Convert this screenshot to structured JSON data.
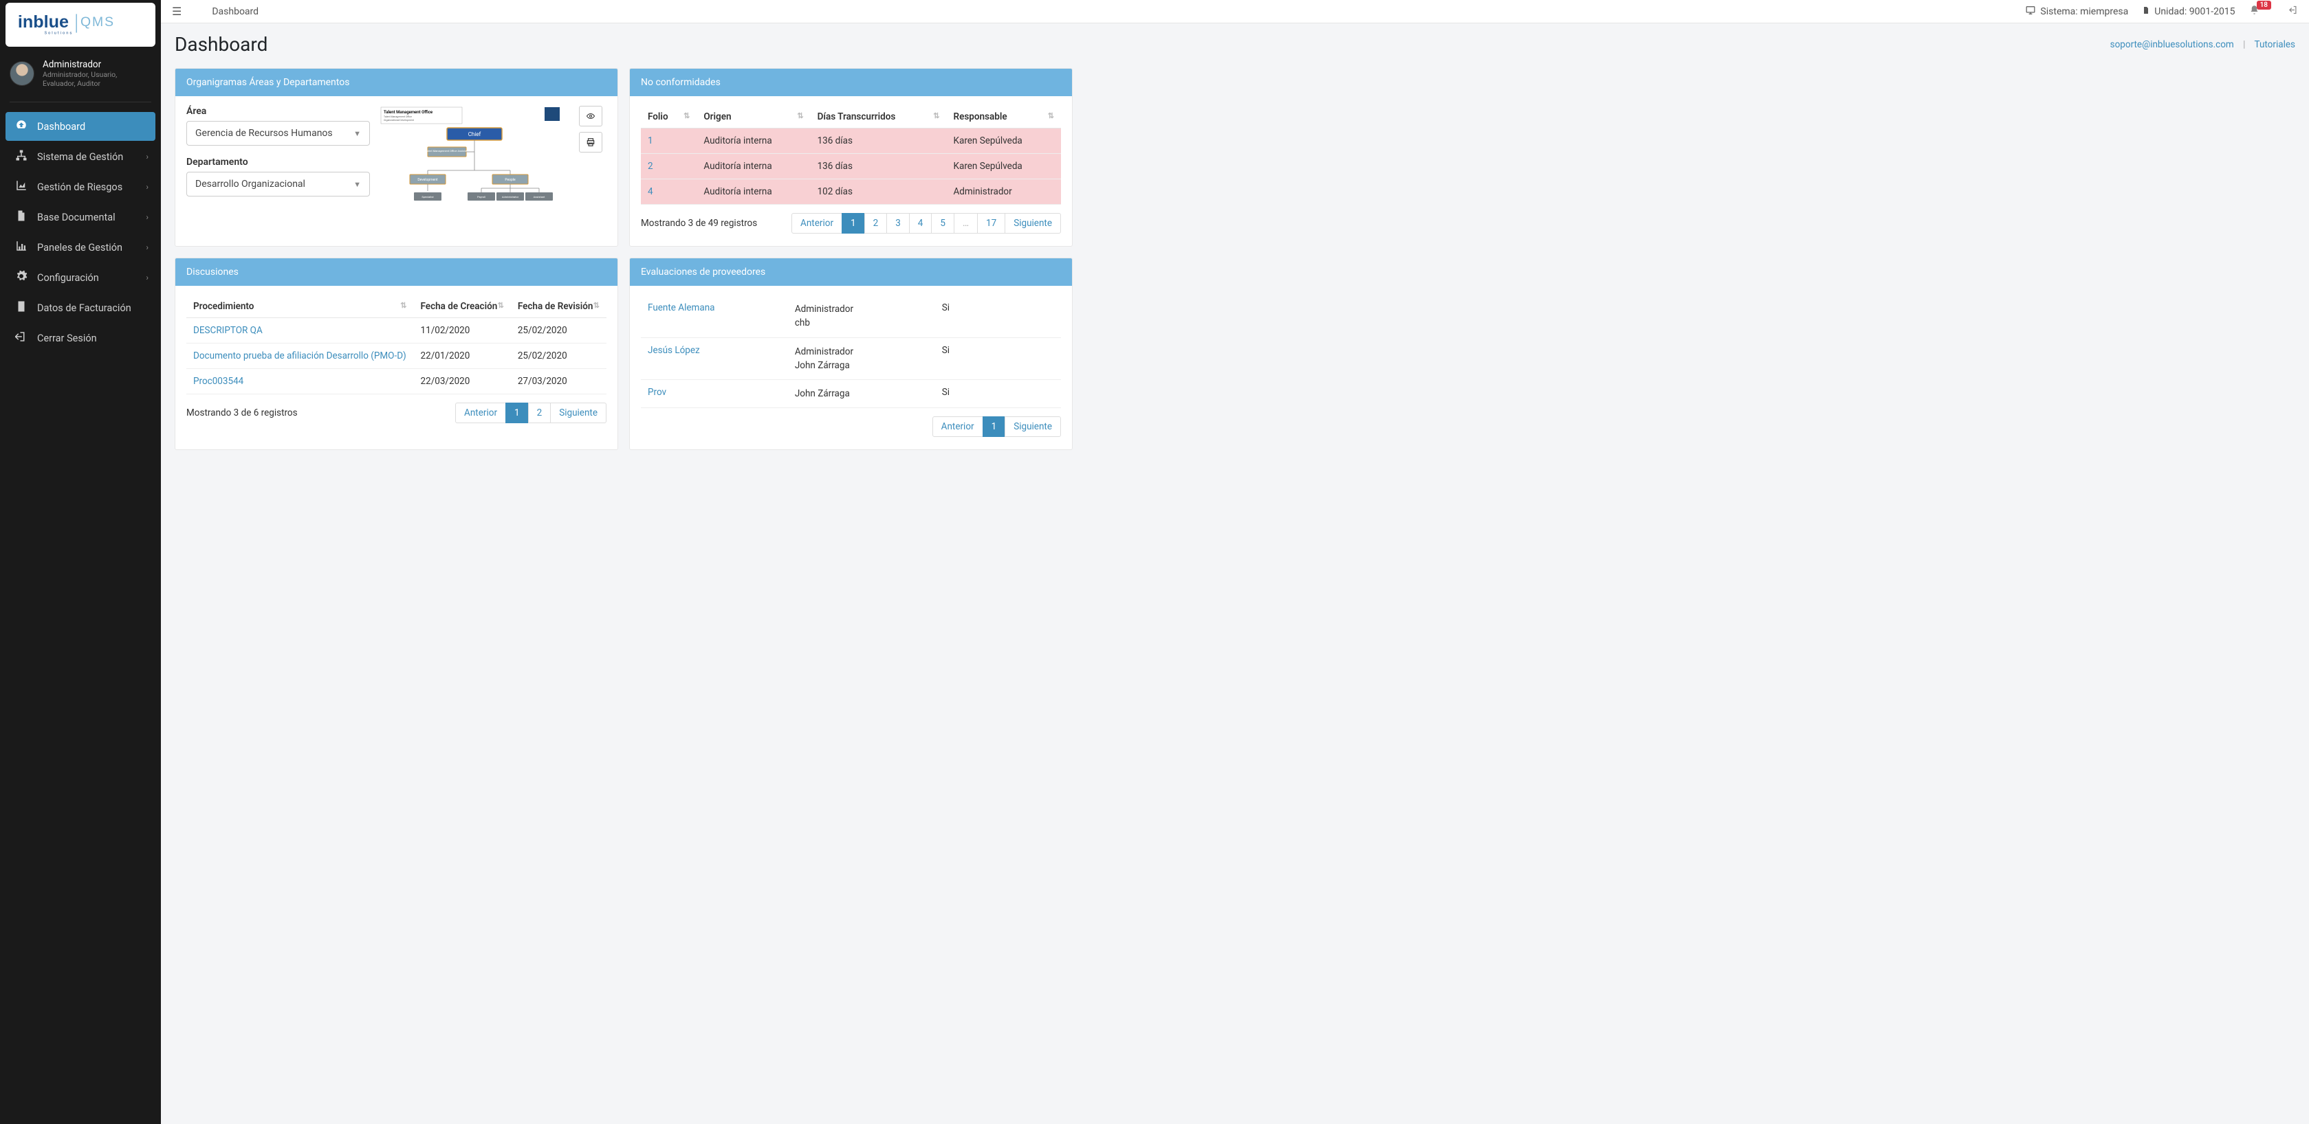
{
  "brand": {
    "name": "inblue",
    "suffix": "QMS",
    "sub": "Solutions"
  },
  "user": {
    "name": "Administrador",
    "roles": "Administrador, Usuario, Evaluador, Auditor"
  },
  "nav": [
    {
      "label": "Dashboard",
      "icon": "tachometer-icon",
      "active": true,
      "chev": false
    },
    {
      "label": "Sistema de Gestión",
      "icon": "sitemap-icon",
      "active": false,
      "chev": true
    },
    {
      "label": "Gestión de Riesgos",
      "icon": "area-chart-icon",
      "active": false,
      "chev": true
    },
    {
      "label": "Base Documental",
      "icon": "file-icon",
      "active": false,
      "chev": true
    },
    {
      "label": "Paneles de Gestión",
      "icon": "bar-chart-icon",
      "active": false,
      "chev": true
    },
    {
      "label": "Configuración",
      "icon": "gear-icon",
      "active": false,
      "chev": true
    },
    {
      "label": "Datos de Facturación",
      "icon": "invoice-icon",
      "active": false,
      "chev": false
    },
    {
      "label": "Cerrar Sesión",
      "icon": "signout-icon",
      "active": false,
      "chev": false
    }
  ],
  "topbar": {
    "crumb": "Dashboard",
    "sistema_label": "Sistema: miempresa",
    "unidad_label": "Unidad: 9001-2015",
    "alert_count": "18"
  },
  "page": {
    "title": "Dashboard",
    "support_email": "soporte@inbluesolutions.com",
    "tutorials": "Tutoriales"
  },
  "cards": {
    "org": {
      "title": "Organigramas Áreas y Departamentos",
      "area_label": "Área",
      "area_value": "Gerencia de Recursos Humanos",
      "dept_label": "Departamento",
      "dept_value": "Desarrollo Organizacional",
      "chart": {
        "company_title": "Talent Management Office",
        "root": "Chief",
        "assistant": "Talent Management Office Assistant",
        "left": "Development",
        "right": "People",
        "leaves": [
          "Specialist",
          "Payroll",
          "Administrator",
          "Assistant"
        ]
      }
    },
    "nonconf": {
      "title": "No conformidades",
      "columns": [
        "Folio",
        "Origen",
        "Días Transcurridos",
        "Responsable"
      ],
      "rows": [
        {
          "folio": "1",
          "origen": "Auditoría interna",
          "dias": "136 días",
          "resp": "Karen Sepúlveda"
        },
        {
          "folio": "2",
          "origen": "Auditoría interna",
          "dias": "136 días",
          "resp": "Karen Sepúlveda"
        },
        {
          "folio": "4",
          "origen": "Auditoría interna",
          "dias": "102 días",
          "resp": "Administrador"
        }
      ],
      "info": "Mostrando 3 de 49 registros",
      "pages": {
        "prev": "Anterior",
        "next": "Siguiente",
        "nums": [
          "1",
          "2",
          "3",
          "4",
          "5",
          "…",
          "17"
        ],
        "active": "1"
      }
    },
    "disc": {
      "title": "Discusiones",
      "columns": [
        "Procedimiento",
        "Fecha de Creación",
        "Fecha de Revisión"
      ],
      "rows": [
        {
          "proc": "DESCRIPTOR QA",
          "creacion": "11/02/2020",
          "revision": "25/02/2020"
        },
        {
          "proc": "Documento prueba de afiliación Desarrollo (PMO-D)",
          "creacion": "22/01/2020",
          "revision": "25/02/2020"
        },
        {
          "proc": "Proc003544",
          "creacion": "22/03/2020",
          "revision": "27/03/2020"
        }
      ],
      "info": "Mostrando 3 de 6 registros",
      "pages": {
        "prev": "Anterior",
        "next": "Siguiente",
        "nums": [
          "1",
          "2"
        ],
        "active": "1"
      }
    },
    "eval": {
      "title": "Evaluaciones de proveedores",
      "rows": [
        {
          "prov": "Fuente Alemana",
          "approvers": "Administrador\nchb",
          "aprobado": "Si"
        },
        {
          "prov": "Jesús López",
          "approvers": "Administrador\nJohn Zárraga",
          "aprobado": "Si"
        },
        {
          "prov": "Prov",
          "approvers": "John Zárraga",
          "aprobado": "Si"
        }
      ],
      "pages": {
        "prev": "Anterior",
        "next": "Siguiente",
        "nums": [
          "1"
        ],
        "active": "1"
      }
    }
  }
}
